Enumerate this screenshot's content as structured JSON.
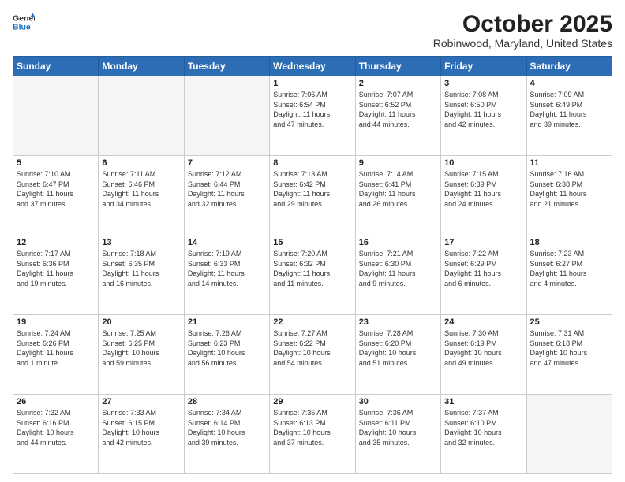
{
  "header": {
    "logo_line1": "General",
    "logo_line2": "Blue",
    "title": "October 2025",
    "subtitle": "Robinwood, Maryland, United States"
  },
  "days_of_week": [
    "Sunday",
    "Monday",
    "Tuesday",
    "Wednesday",
    "Thursday",
    "Friday",
    "Saturday"
  ],
  "weeks": [
    [
      {
        "day": "",
        "info": ""
      },
      {
        "day": "",
        "info": ""
      },
      {
        "day": "",
        "info": ""
      },
      {
        "day": "1",
        "info": "Sunrise: 7:06 AM\nSunset: 6:54 PM\nDaylight: 11 hours\nand 47 minutes."
      },
      {
        "day": "2",
        "info": "Sunrise: 7:07 AM\nSunset: 6:52 PM\nDaylight: 11 hours\nand 44 minutes."
      },
      {
        "day": "3",
        "info": "Sunrise: 7:08 AM\nSunset: 6:50 PM\nDaylight: 11 hours\nand 42 minutes."
      },
      {
        "day": "4",
        "info": "Sunrise: 7:09 AM\nSunset: 6:49 PM\nDaylight: 11 hours\nand 39 minutes."
      }
    ],
    [
      {
        "day": "5",
        "info": "Sunrise: 7:10 AM\nSunset: 6:47 PM\nDaylight: 11 hours\nand 37 minutes."
      },
      {
        "day": "6",
        "info": "Sunrise: 7:11 AM\nSunset: 6:46 PM\nDaylight: 11 hours\nand 34 minutes."
      },
      {
        "day": "7",
        "info": "Sunrise: 7:12 AM\nSunset: 6:44 PM\nDaylight: 11 hours\nand 32 minutes."
      },
      {
        "day": "8",
        "info": "Sunrise: 7:13 AM\nSunset: 6:42 PM\nDaylight: 11 hours\nand 29 minutes."
      },
      {
        "day": "9",
        "info": "Sunrise: 7:14 AM\nSunset: 6:41 PM\nDaylight: 11 hours\nand 26 minutes."
      },
      {
        "day": "10",
        "info": "Sunrise: 7:15 AM\nSunset: 6:39 PM\nDaylight: 11 hours\nand 24 minutes."
      },
      {
        "day": "11",
        "info": "Sunrise: 7:16 AM\nSunset: 6:38 PM\nDaylight: 11 hours\nand 21 minutes."
      }
    ],
    [
      {
        "day": "12",
        "info": "Sunrise: 7:17 AM\nSunset: 6:36 PM\nDaylight: 11 hours\nand 19 minutes."
      },
      {
        "day": "13",
        "info": "Sunrise: 7:18 AM\nSunset: 6:35 PM\nDaylight: 11 hours\nand 16 minutes."
      },
      {
        "day": "14",
        "info": "Sunrise: 7:19 AM\nSunset: 6:33 PM\nDaylight: 11 hours\nand 14 minutes."
      },
      {
        "day": "15",
        "info": "Sunrise: 7:20 AM\nSunset: 6:32 PM\nDaylight: 11 hours\nand 11 minutes."
      },
      {
        "day": "16",
        "info": "Sunrise: 7:21 AM\nSunset: 6:30 PM\nDaylight: 11 hours\nand 9 minutes."
      },
      {
        "day": "17",
        "info": "Sunrise: 7:22 AM\nSunset: 6:29 PM\nDaylight: 11 hours\nand 6 minutes."
      },
      {
        "day": "18",
        "info": "Sunrise: 7:23 AM\nSunset: 6:27 PM\nDaylight: 11 hours\nand 4 minutes."
      }
    ],
    [
      {
        "day": "19",
        "info": "Sunrise: 7:24 AM\nSunset: 6:26 PM\nDaylight: 11 hours\nand 1 minute."
      },
      {
        "day": "20",
        "info": "Sunrise: 7:25 AM\nSunset: 6:25 PM\nDaylight: 10 hours\nand 59 minutes."
      },
      {
        "day": "21",
        "info": "Sunrise: 7:26 AM\nSunset: 6:23 PM\nDaylight: 10 hours\nand 56 minutes."
      },
      {
        "day": "22",
        "info": "Sunrise: 7:27 AM\nSunset: 6:22 PM\nDaylight: 10 hours\nand 54 minutes."
      },
      {
        "day": "23",
        "info": "Sunrise: 7:28 AM\nSunset: 6:20 PM\nDaylight: 10 hours\nand 51 minutes."
      },
      {
        "day": "24",
        "info": "Sunrise: 7:30 AM\nSunset: 6:19 PM\nDaylight: 10 hours\nand 49 minutes."
      },
      {
        "day": "25",
        "info": "Sunrise: 7:31 AM\nSunset: 6:18 PM\nDaylight: 10 hours\nand 47 minutes."
      }
    ],
    [
      {
        "day": "26",
        "info": "Sunrise: 7:32 AM\nSunset: 6:16 PM\nDaylight: 10 hours\nand 44 minutes."
      },
      {
        "day": "27",
        "info": "Sunrise: 7:33 AM\nSunset: 6:15 PM\nDaylight: 10 hours\nand 42 minutes."
      },
      {
        "day": "28",
        "info": "Sunrise: 7:34 AM\nSunset: 6:14 PM\nDaylight: 10 hours\nand 39 minutes."
      },
      {
        "day": "29",
        "info": "Sunrise: 7:35 AM\nSunset: 6:13 PM\nDaylight: 10 hours\nand 37 minutes."
      },
      {
        "day": "30",
        "info": "Sunrise: 7:36 AM\nSunset: 6:11 PM\nDaylight: 10 hours\nand 35 minutes."
      },
      {
        "day": "31",
        "info": "Sunrise: 7:37 AM\nSunset: 6:10 PM\nDaylight: 10 hours\nand 32 minutes."
      },
      {
        "day": "",
        "info": ""
      }
    ]
  ]
}
